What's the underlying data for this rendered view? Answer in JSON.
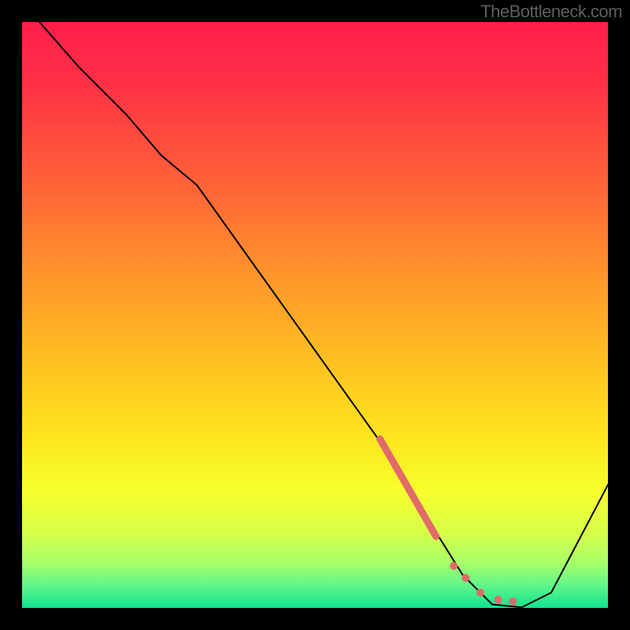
{
  "watermark": "TheBottleneck.com",
  "chart_data": {
    "type": "line",
    "title": "",
    "xlabel": "",
    "ylabel": "",
    "xlim": [
      0,
      100
    ],
    "ylim": [
      0,
      100
    ],
    "grid": false,
    "legend": false,
    "series": [
      {
        "name": "bottleneck-curve",
        "stroke": "#000000",
        "stroke_width": 2,
        "x": [
          3,
          10,
          18,
          24,
          30,
          40,
          50,
          60,
          65,
          70,
          75,
          80,
          85,
          90,
          100
        ],
        "y": [
          100,
          92,
          84,
          77,
          72,
          58,
          44,
          30,
          23,
          14,
          6,
          1,
          0.5,
          3,
          22
        ]
      }
    ],
    "highlight_segment": {
      "name": "critical-segment",
      "stroke": "#E16A6A",
      "stroke_width": 9,
      "x": [
        61,
        70.5
      ],
      "y": [
        29,
        12.5
      ]
    },
    "dots": {
      "fill": "#E16A6A",
      "radius": 5,
      "points": [
        {
          "x": 73.5,
          "y": 7.5
        },
        {
          "x": 75.5,
          "y": 5.5
        },
        {
          "x": 78.0,
          "y": 3.0
        },
        {
          "x": 81.0,
          "y": 1.8
        },
        {
          "x": 83.5,
          "y": 1.5
        }
      ]
    },
    "background_gradient": {
      "stops": [
        {
          "offset": 0.0,
          "color": "#FF1E4B"
        },
        {
          "offset": 0.1,
          "color": "#FF2F46"
        },
        {
          "offset": 0.25,
          "color": "#FF5A3A"
        },
        {
          "offset": 0.4,
          "color": "#FF8A2E"
        },
        {
          "offset": 0.55,
          "color": "#FFB824"
        },
        {
          "offset": 0.7,
          "color": "#FFE31E"
        },
        {
          "offset": 0.8,
          "color": "#F7FF2C"
        },
        {
          "offset": 0.87,
          "color": "#D6FF4A"
        },
        {
          "offset": 0.92,
          "color": "#A8FF6A"
        },
        {
          "offset": 0.96,
          "color": "#5CF58B"
        },
        {
          "offset": 1.0,
          "color": "#07E18F"
        }
      ]
    }
  }
}
